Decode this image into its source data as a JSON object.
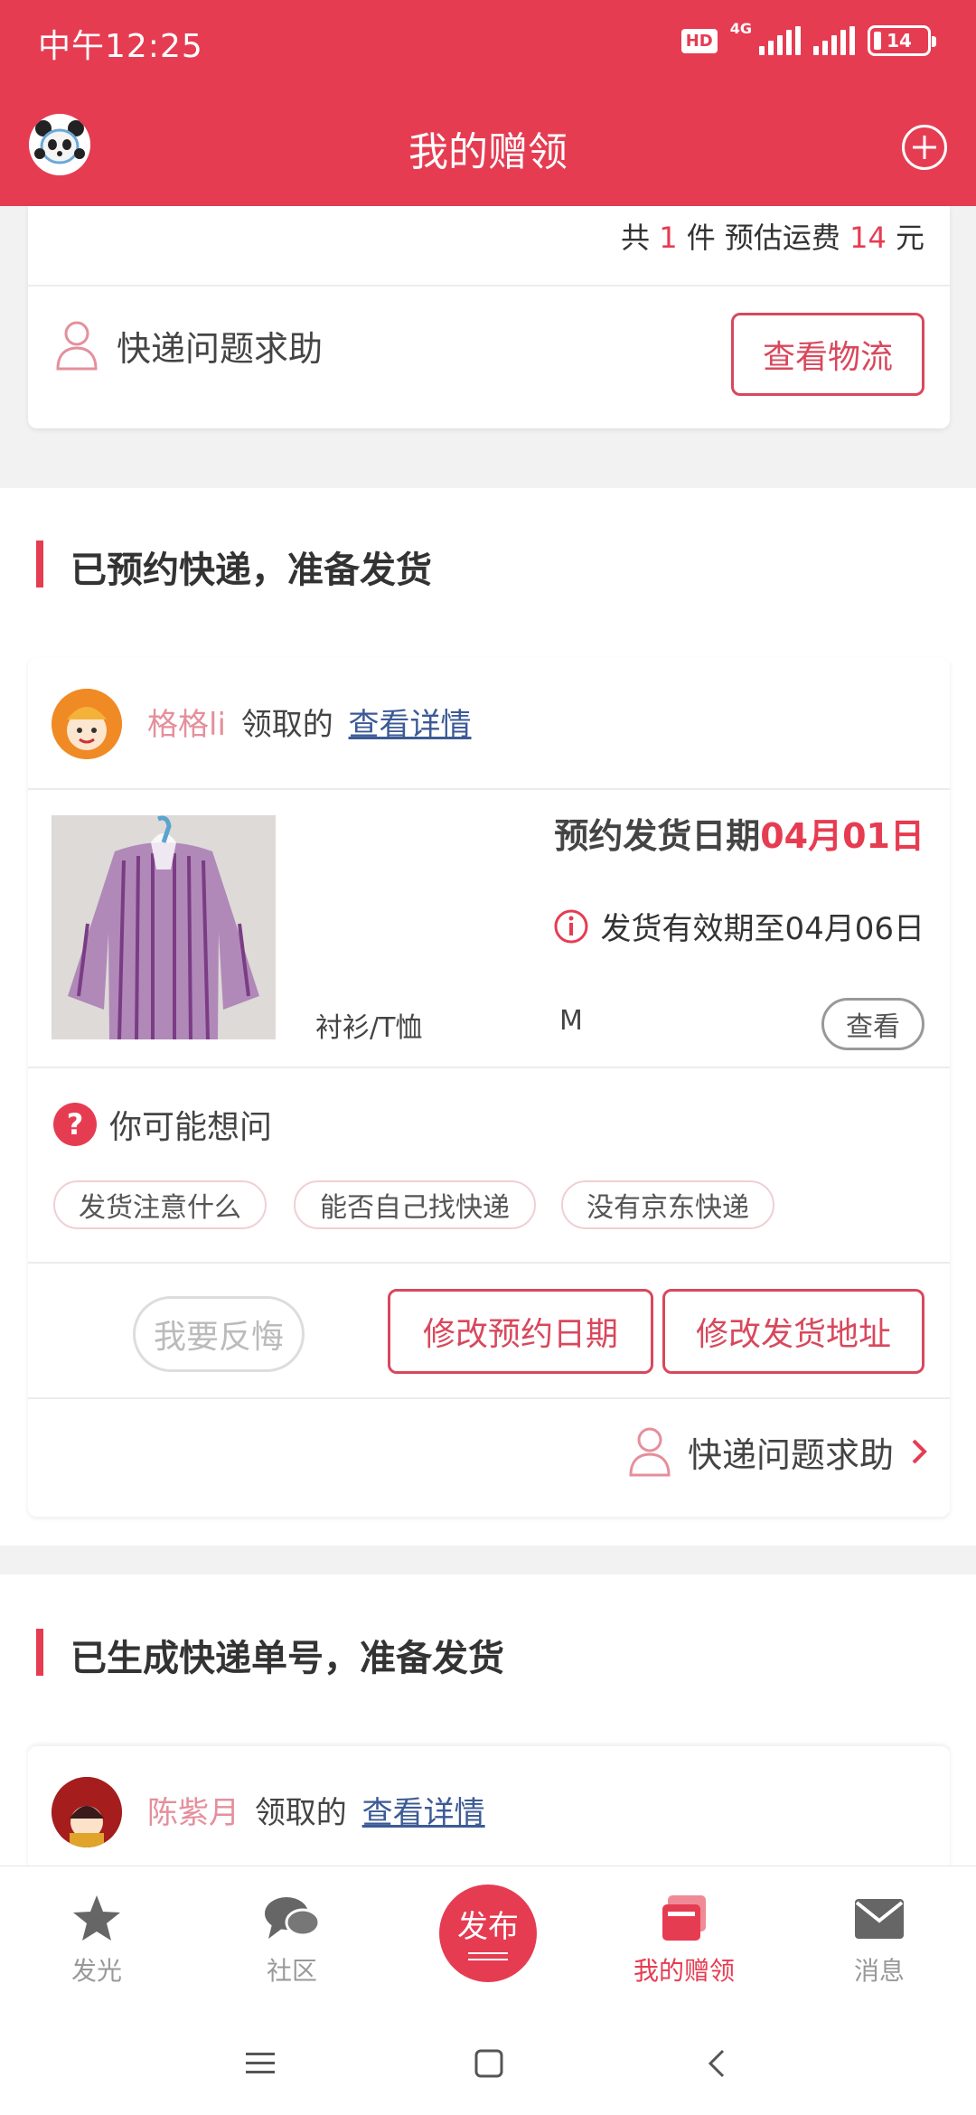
{
  "status": {
    "time": "中午12:25",
    "hd": "HD",
    "network": "4G",
    "battery": "14"
  },
  "header": {
    "title": "我的赠领"
  },
  "card_top": {
    "summary_prefix": "共",
    "count": "1",
    "summary_mid": "件 预估运费",
    "fee": "14",
    "summary_suffix": "元",
    "help_label": "快递问题求助",
    "logistics_button": "查看物流"
  },
  "section1": {
    "title": "已预约快递，准备发货",
    "user_name": "格格li",
    "claimed": "领取的",
    "detail_link": "查看详情",
    "ship_label": "预约发货日期",
    "ship_date": "04月01日",
    "valid_text": "发货有效期至04月06日",
    "category": "衬衫/T恤",
    "size": "M",
    "view_button": "查看",
    "faq_title": "你可能想问",
    "faq_tags": [
      "发货注意什么",
      "能否自己找快递",
      "没有京东快递"
    ],
    "regret_button": "我要反悔",
    "change_date_button": "修改预约日期",
    "change_address_button": "修改发货地址",
    "help_label": "快递问题求助"
  },
  "section2": {
    "title": "已生成快递单号，准备发货",
    "user_name": "陈紫月",
    "claimed": "领取的",
    "detail_link": "查看详情"
  },
  "nav": {
    "items": [
      {
        "label": "发光",
        "icon": "star-icon"
      },
      {
        "label": "社区",
        "icon": "chat-bubble-icon"
      },
      {
        "label": "发布",
        "icon": "publish-icon"
      },
      {
        "label": "我的赠领",
        "icon": "gift-card-icon"
      },
      {
        "label": "消息",
        "icon": "mail-icon"
      }
    ],
    "active": "我的赠领"
  },
  "colors": {
    "brand": "#e63c52",
    "link": "#3c5a96",
    "username": "#e58f9c"
  }
}
